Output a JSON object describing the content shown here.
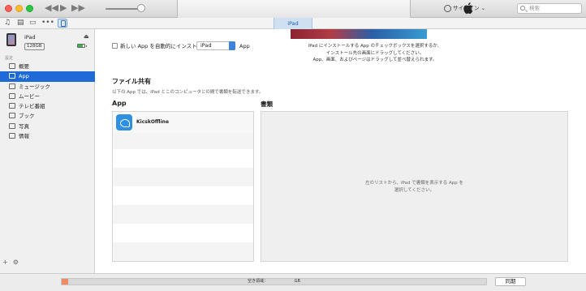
{
  "window": {
    "device_tab": "iPad"
  },
  "account": {
    "signin_label": "サインイン"
  },
  "search": {
    "placeholder": "検索"
  },
  "device": {
    "name": "iPad",
    "capacity": "128GB"
  },
  "sidebar": {
    "section_label": "設定",
    "items": [
      {
        "label": "概要",
        "active": false,
        "icon": "summary-icon"
      },
      {
        "label": "App",
        "active": true,
        "icon": "app-icon"
      },
      {
        "label": "ミュージック",
        "active": false,
        "icon": "music-icon"
      },
      {
        "label": "ムービー",
        "active": false,
        "icon": "movie-icon"
      },
      {
        "label": "テレビ番組",
        "active": false,
        "icon": "tv-icon"
      },
      {
        "label": "ブック",
        "active": false,
        "icon": "book-icon"
      },
      {
        "label": "写真",
        "active": false,
        "icon": "camera-icon"
      },
      {
        "label": "情報",
        "active": false,
        "icon": "info-icon"
      }
    ],
    "add_label": "+",
    "settings_label": "⚙"
  },
  "apps_section": {
    "auto_install_label": "新しい App を自動的にインストール",
    "device_select_value": "iPad",
    "select_suffix": "App",
    "hint_lines": [
      "iPad にインストールする App のチェックボックスを選択するか、",
      "インストール先の画面にドラッグしてください。",
      "App、画面、およびページはドラッグして並べ替えられます。"
    ]
  },
  "file_sharing": {
    "title": "ファイル共有",
    "description": "以下の App では、iPad とこのコンピュータとの間で書類を転送できます。",
    "apps_header": "App",
    "docs_header": "書類",
    "apps": [
      {
        "name": "KicskOffline"
      }
    ],
    "docs_empty_lines": [
      "左のリストから、iPad で書類を表示する App を",
      "選択してください。"
    ]
  },
  "status": {
    "storage_label": "空き領域：　　　　　　　GB",
    "storage_used_fraction": 0.015,
    "sync_label": "同期"
  },
  "colors": {
    "accent": "#1e6bd8",
    "storage_used": "#ef8a64"
  }
}
